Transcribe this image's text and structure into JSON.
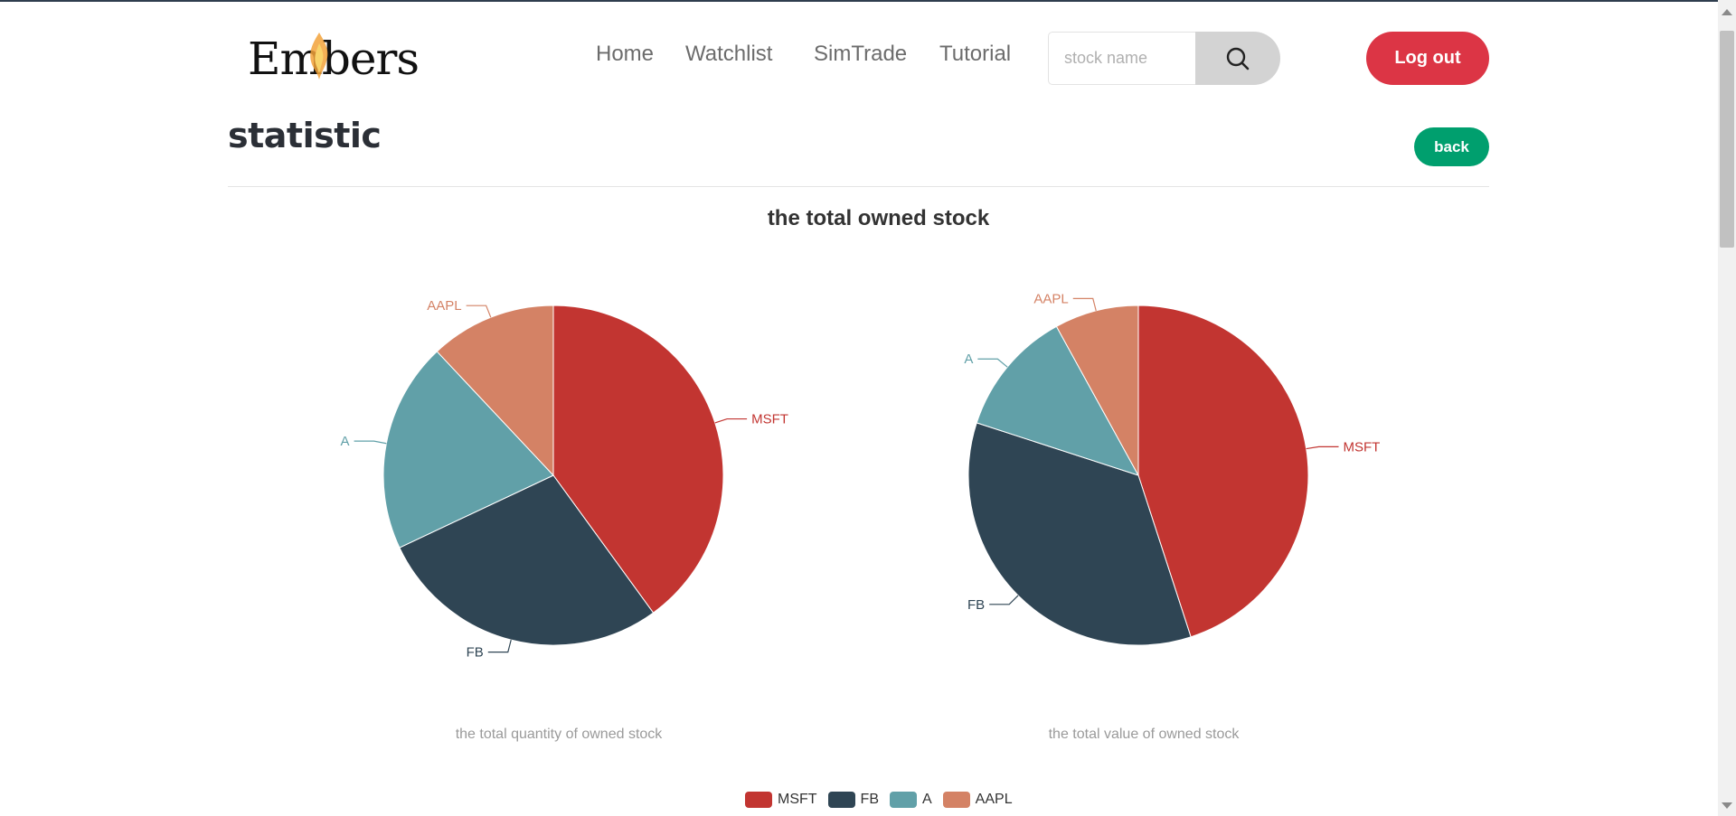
{
  "brand": {
    "name": "Embers"
  },
  "nav": {
    "items": [
      {
        "label": "Home"
      },
      {
        "label": "Watchlist"
      },
      {
        "label": "SimTrade"
      },
      {
        "label": "Tutorial"
      }
    ]
  },
  "search": {
    "placeholder": "stock name",
    "value": ""
  },
  "header": {
    "logout_label": "Log out"
  },
  "page": {
    "title": "statistic",
    "back_label": "back"
  },
  "section": {
    "heading": "the total owned stock"
  },
  "colors": {
    "MSFT": "#c23531",
    "FB": "#2f4554",
    "A": "#61a0a8",
    "AAPL": "#d48265",
    "logout": "#dc3545",
    "back": "#009f6e"
  },
  "chart_data": [
    {
      "type": "pie",
      "title": "the total quantity of owned stock",
      "categories": [
        "MSFT",
        "FB",
        "A",
        "AAPL"
      ],
      "values": [
        40,
        28,
        20,
        12
      ]
    },
    {
      "type": "pie",
      "title": "the total value of owned stock",
      "categories": [
        "MSFT",
        "FB",
        "A",
        "AAPL"
      ],
      "values": [
        45,
        35,
        12,
        8
      ]
    }
  ],
  "legend": {
    "items": [
      {
        "label": "MSFT"
      },
      {
        "label": "FB"
      },
      {
        "label": "A"
      },
      {
        "label": "AAPL"
      }
    ],
    "placement": "bottom-center"
  }
}
